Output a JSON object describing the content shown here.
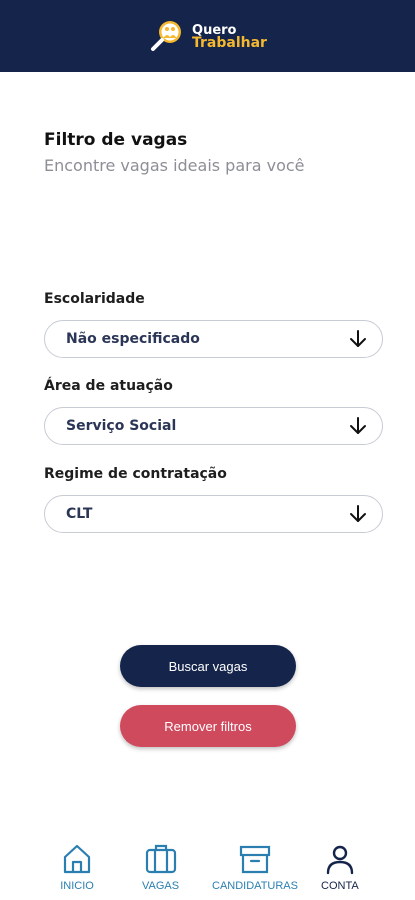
{
  "header": {
    "logo_line1": "Quero",
    "logo_line2": "Trabalhar",
    "colors": {
      "background": "#14244a",
      "accent": "#f5b82e"
    }
  },
  "page": {
    "title": "Filtro de vagas",
    "subtitle": "Encontre vagas ideais para você"
  },
  "filters": [
    {
      "label": "Escolaridade",
      "value": "Não especificado",
      "icon": "arrow-down-icon"
    },
    {
      "label": "Área de atuação",
      "value": "Serviço Social",
      "icon": "arrow-down-icon"
    },
    {
      "label": "Regime de contratação",
      "value": "CLT",
      "icon": "arrow-down-icon"
    }
  ],
  "actions": {
    "search_label": "Buscar vagas",
    "clear_label": "Remover filtros",
    "colors": {
      "primary": "#14244a",
      "danger": "#d04a5e"
    }
  },
  "bottom_nav": [
    {
      "label": "INICIO",
      "icon": "home-icon",
      "active": false
    },
    {
      "label": "VAGAS",
      "icon": "briefcase-icon",
      "active": false
    },
    {
      "label": "CANDIDATURAS",
      "icon": "archive-box-icon",
      "active": false
    },
    {
      "label": "CONTA",
      "icon": "user-icon",
      "active": true
    }
  ]
}
